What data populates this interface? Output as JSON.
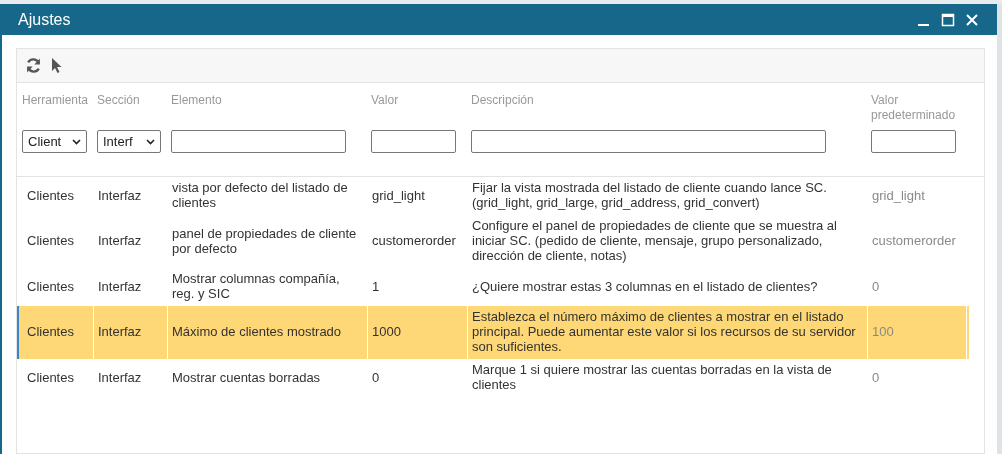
{
  "window": {
    "title": "Ajustes"
  },
  "table": {
    "columns": [
      "Herramienta",
      "Sección",
      "Elemento",
      "Valor",
      "Descripción",
      "Valor predeterminado"
    ],
    "filters": [
      {
        "kind": "select",
        "value": "Client"
      },
      {
        "kind": "select",
        "value": "Interf"
      },
      {
        "kind": "text"
      },
      {
        "kind": "text"
      },
      {
        "kind": "text"
      },
      {
        "kind": "text"
      }
    ],
    "rows": [
      {
        "selected": false,
        "cells": [
          "Clientes",
          "Interfaz",
          "vista por defecto del listado de clientes",
          "grid_light",
          "Fijar la vista mostrada del listado de cliente cuando lance SC. (grid_light, grid_large, grid_address, grid_convert)",
          "grid_light"
        ]
      },
      {
        "selected": false,
        "cells": [
          "Clientes",
          "Interfaz",
          "panel de propiedades de cliente por defecto",
          "customerorder",
          "Configure el panel de propiedades de cliente que se muestra al iniciar SC. (pedido de cliente, mensaje, grupo personalizado, dirección de cliente, notas)",
          "customerorder"
        ]
      },
      {
        "selected": false,
        "cells": [
          "Clientes",
          "Interfaz",
          "Mostrar columnas compañía, reg. y SIC",
          "1",
          "¿Quiere mostrar estas 3 columnas en el listado de clientes?",
          "0"
        ]
      },
      {
        "selected": true,
        "cells": [
          "Clientes",
          "Interfaz",
          "Máximo de clientes mostrado",
          "1000",
          "Establezca el número máximo de clientes a mostrar en el listado principal. Puede aumentar este valor si los recursos de su servidor son suficientes.",
          "100"
        ]
      },
      {
        "selected": false,
        "cells": [
          "Clientes",
          "Interfaz",
          "Mostrar cuentas borradas",
          "0",
          "Marque 1 si quiere mostrar las cuentas borradas en la vista de clientes",
          "0"
        ]
      }
    ]
  }
}
